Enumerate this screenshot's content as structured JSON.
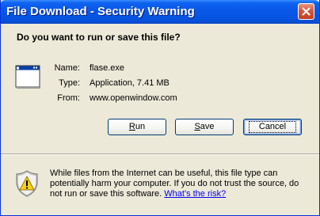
{
  "window": {
    "title": "File Download - Security Warning"
  },
  "dialog": {
    "question": "Do you want to run or save this file?",
    "file": {
      "name_label": "Name:",
      "name_value": "flase.exe",
      "type_label": "Type:",
      "type_value": "Application, 7.41 MB",
      "from_label": "From:",
      "from_value": "www.openwindow.com"
    },
    "buttons": {
      "run_accel": "R",
      "run_rest": "un",
      "save_accel": "S",
      "save_rest": "ave",
      "cancel": "Cancel"
    },
    "warning": {
      "text": "While files from the Internet can be useful, this file type can potentially harm your computer. If you do not trust the source, do not run or save this software.",
      "link": "What's the risk?"
    }
  },
  "icons": {
    "close": "close-icon",
    "file": "application-file-icon",
    "warning": "warning-shield-icon"
  },
  "colors": {
    "titlebar": "#0554e3",
    "dialog_bg": "#ece9d8",
    "close_button": "#d3573c",
    "link": "#0000ee"
  }
}
